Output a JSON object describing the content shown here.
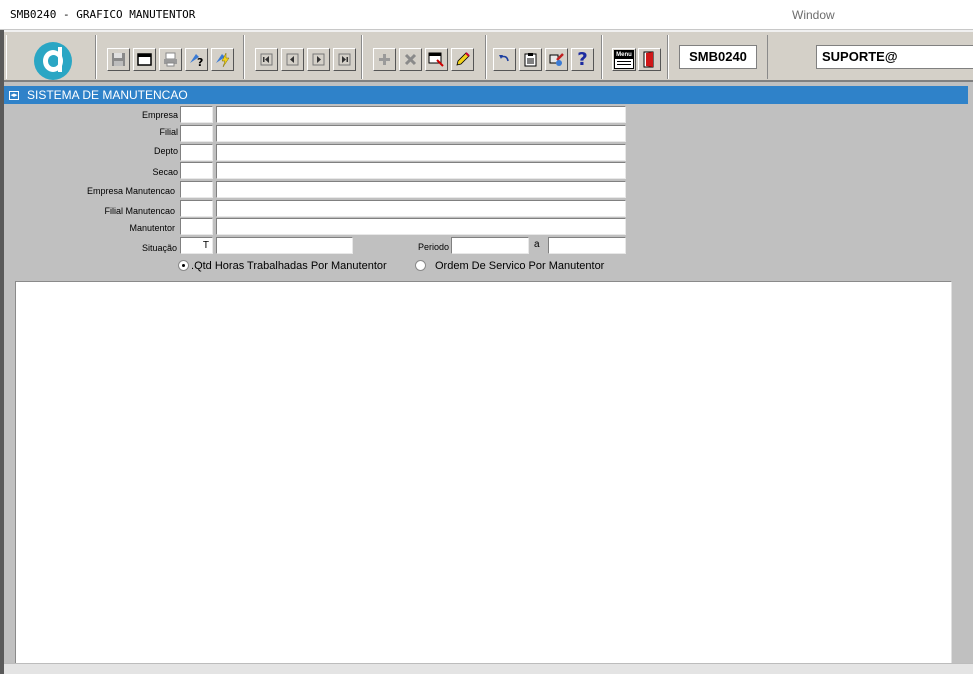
{
  "window": {
    "title": "SMB0240 - GRAFICO MANUTENTOR",
    "menu_window": "Window"
  },
  "toolbar": {
    "form_code": "SMB0240",
    "user": "SUPORTE@",
    "buttons": [
      {
        "name": "save-button",
        "icon": "floppy-icon"
      },
      {
        "name": "window-button",
        "icon": "window-icon"
      },
      {
        "name": "print-button",
        "icon": "printer-icon"
      },
      {
        "name": "query-button",
        "icon": "query-icon"
      },
      {
        "name": "execute-query-button",
        "icon": "lightning-icon"
      },
      {
        "name": "first-record-button",
        "icon": "first-icon"
      },
      {
        "name": "prev-record-button",
        "icon": "prev-icon"
      },
      {
        "name": "next-record-button",
        "icon": "next-icon"
      },
      {
        "name": "last-record-button",
        "icon": "last-icon"
      },
      {
        "name": "insert-record-button",
        "icon": "plus-icon"
      },
      {
        "name": "delete-record-button",
        "icon": "x-icon"
      },
      {
        "name": "duplicate-record-button",
        "icon": "duplicate-icon"
      },
      {
        "name": "edit-button",
        "icon": "pencil-icon"
      },
      {
        "name": "undo-button",
        "icon": "undo-icon"
      },
      {
        "name": "list-button",
        "icon": "clipboard-icon"
      },
      {
        "name": "tools-button",
        "icon": "tools-icon"
      },
      {
        "name": "help-button",
        "icon": "question-icon",
        "glyph": "?"
      },
      {
        "name": "menu-button",
        "icon": "menu-icon",
        "label": "Menu"
      },
      {
        "name": "exit-button",
        "icon": "door-icon"
      }
    ]
  },
  "section": {
    "title": "SISTEMA DE MANUTENCAO"
  },
  "form": {
    "empresa": {
      "label": "Empresa",
      "code": "",
      "desc": ""
    },
    "filial": {
      "label": "Filial",
      "code": "",
      "desc": ""
    },
    "depto": {
      "label": "Depto",
      "code": "",
      "desc": ""
    },
    "secao": {
      "label": "Secao",
      "code": "",
      "desc": ""
    },
    "empresa_manut": {
      "label": "Empresa Manutencao",
      "code": "",
      "desc": ""
    },
    "filial_manut": {
      "label": "Filial Manutencao",
      "code": "",
      "desc": ""
    },
    "manutentor": {
      "label": "Manutentor",
      "code": "",
      "desc": ""
    },
    "situacao": {
      "label": "Situação",
      "code": "T",
      "desc": ""
    },
    "periodo": {
      "label": "Periodo",
      "from": "",
      "sep": "a",
      "to": ""
    },
    "report_options": [
      {
        "label": "Qtd Horas Trabalhadas Por Manutentor",
        "selected": true
      },
      {
        "label": "Ordem De Servico Por Manutentor",
        "selected": false
      }
    ]
  },
  "colors": {
    "section_header": "#2f82c9",
    "logo": "#2aa6c4",
    "background": "#c0c0c0"
  }
}
